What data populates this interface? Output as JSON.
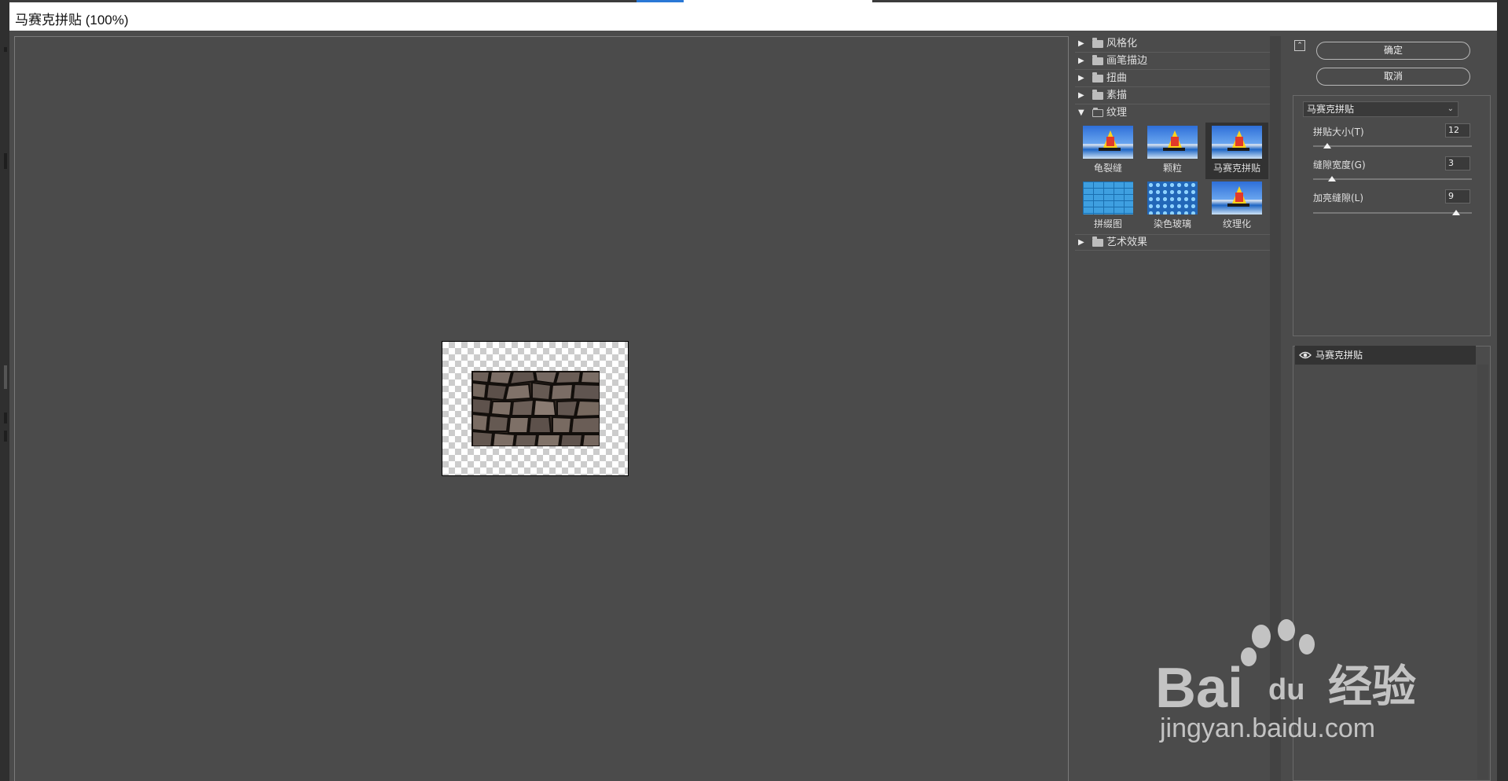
{
  "window": {
    "title": "马赛克拼贴 (100%)"
  },
  "gallery": {
    "categories_top": [
      {
        "label": "风格化",
        "expanded": false
      },
      {
        "label": "画笔描边",
        "expanded": false
      },
      {
        "label": "扭曲",
        "expanded": false
      },
      {
        "label": "素描",
        "expanded": false
      },
      {
        "label": "纹理",
        "expanded": true
      }
    ],
    "texture_filters": [
      {
        "label": "龟裂缝",
        "selected": false
      },
      {
        "label": "颗粒",
        "selected": false
      },
      {
        "label": "马赛克拼贴",
        "selected": true
      },
      {
        "label": "拼缀图",
        "selected": false
      },
      {
        "label": "染色玻璃",
        "selected": false
      },
      {
        "label": "纹理化",
        "selected": false
      }
    ],
    "categories_bottom": [
      {
        "label": "艺术效果",
        "expanded": false
      }
    ]
  },
  "buttons": {
    "ok": "确定",
    "cancel": "取消"
  },
  "settings": {
    "filter_select": "马赛克拼贴",
    "params": [
      {
        "label": "拼贴大小(T)",
        "value": "12",
        "fraction": 0.09
      },
      {
        "label": "缝隙宽度(G)",
        "value": "3",
        "fraction": 0.12
      },
      {
        "label": "加亮缝隙(L)",
        "value": "9",
        "fraction": 0.9
      }
    ]
  },
  "layers": {
    "items": [
      {
        "label": "马赛克拼贴",
        "visible": true
      }
    ]
  },
  "watermark": {
    "brand": "Bai",
    "brand_du": "du",
    "suffix": "经验",
    "url": "jingyan.baidu.com"
  },
  "colors": {
    "panel_bg": "#4b4b4b",
    "selected_bg": "#323232",
    "accent_blue": "#2a78d6"
  }
}
